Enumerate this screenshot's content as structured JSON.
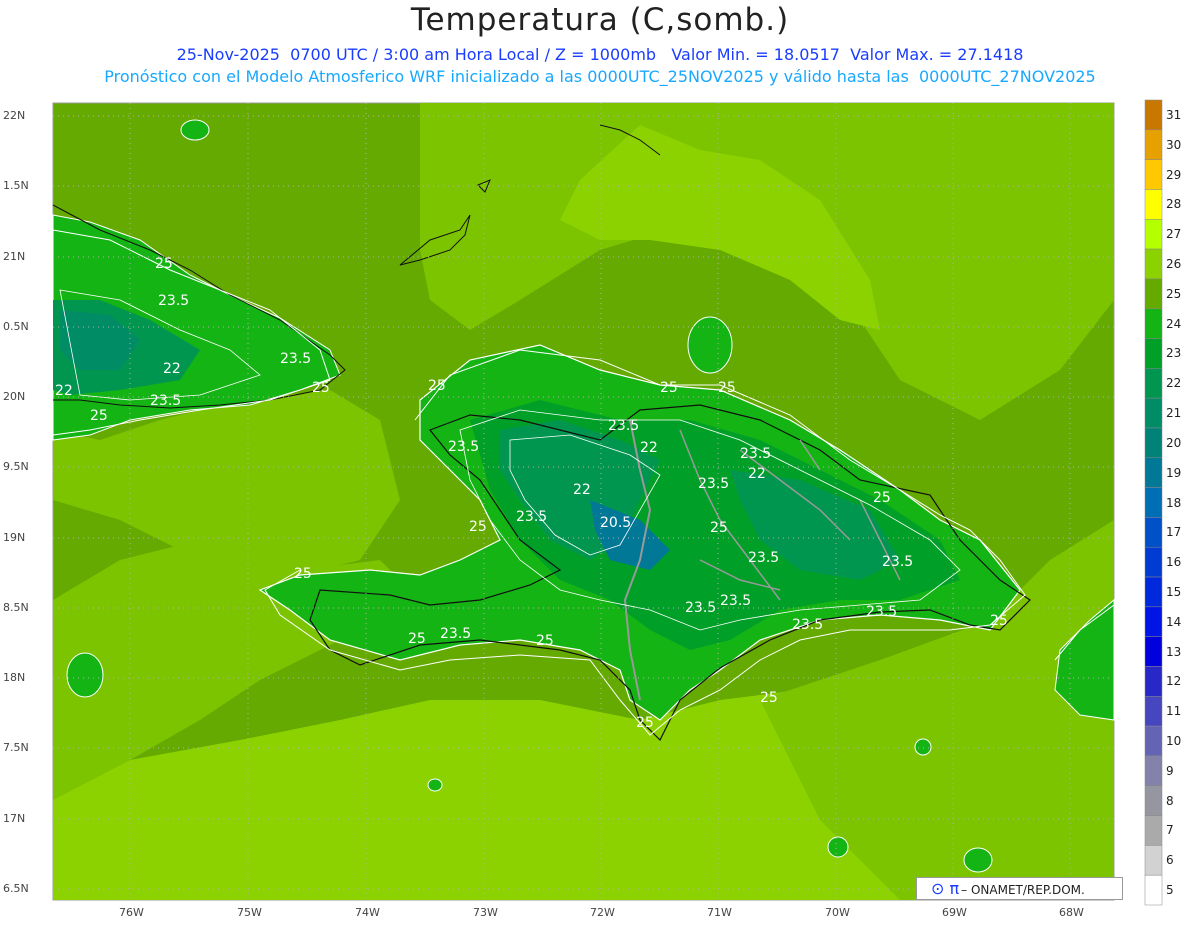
{
  "header": {
    "title": "Temperatura (C,somb.)",
    "line1": "25-Nov-2025  0700 UTC / 3:00 am Hora Local / Z = 1000mb   Valor Min. = 18.0517  Valor Max. = 27.1418",
    "line2": "Pronóstico con el Modelo Atmosferico WRF inicializado a las 0000UTC_25NOV2025 y válido hasta las  0000UTC_27NOV2025"
  },
  "axes": {
    "lat_labels": [
      "22N",
      "1.5N",
      "21N",
      "0.5N",
      "20N",
      "9.5N",
      "19N",
      "8.5N",
      "18N",
      "7.5N",
      "17N",
      "6.5N"
    ],
    "lon_labels": [
      "76W",
      "75W",
      "74W",
      "73W",
      "72W",
      "71W",
      "70W",
      "69W",
      "68W"
    ]
  },
  "colorbar": {
    "labels": [
      "31",
      "30",
      "29",
      "28",
      "27",
      "26",
      "25",
      "24",
      "23",
      "22",
      "21",
      "20",
      "19",
      "18",
      "17",
      "16",
      "15",
      "14",
      "13",
      "12",
      "11",
      "10",
      "9",
      "8",
      "7",
      "6",
      "5"
    ],
    "colors": [
      "#c87800",
      "#e6a000",
      "#ffc800",
      "#ffff00",
      "#b4ff00",
      "#8cd200",
      "#64aa00",
      "#14b414",
      "#00a028",
      "#009650",
      "#008c64",
      "#008278",
      "#007896",
      "#006eb4",
      "#0050c8",
      "#003cd2",
      "#0028dc",
      "#0014e6",
      "#0000dc",
      "#2828c8",
      "#4646be",
      "#6464b4",
      "#8282aa",
      "#9696a0",
      "#aaaaaa",
      "#d2d2d2",
      "#ffffff"
    ]
  },
  "map": {
    "contour_labels": [
      "25",
      "23.5",
      "22",
      "20.5"
    ],
    "colors": {
      "ocean_light": "#8cd200",
      "ocean_mid": "#7cc400",
      "ocean_dark": "#64aa00",
      "land_green": "#14b414",
      "land_mid": "#00a028",
      "land_dark": "#009650",
      "land_teal": "#008c64",
      "land_blue": "#007896"
    }
  },
  "logo": {
    "text": "ONAMET/REP.DOM."
  }
}
